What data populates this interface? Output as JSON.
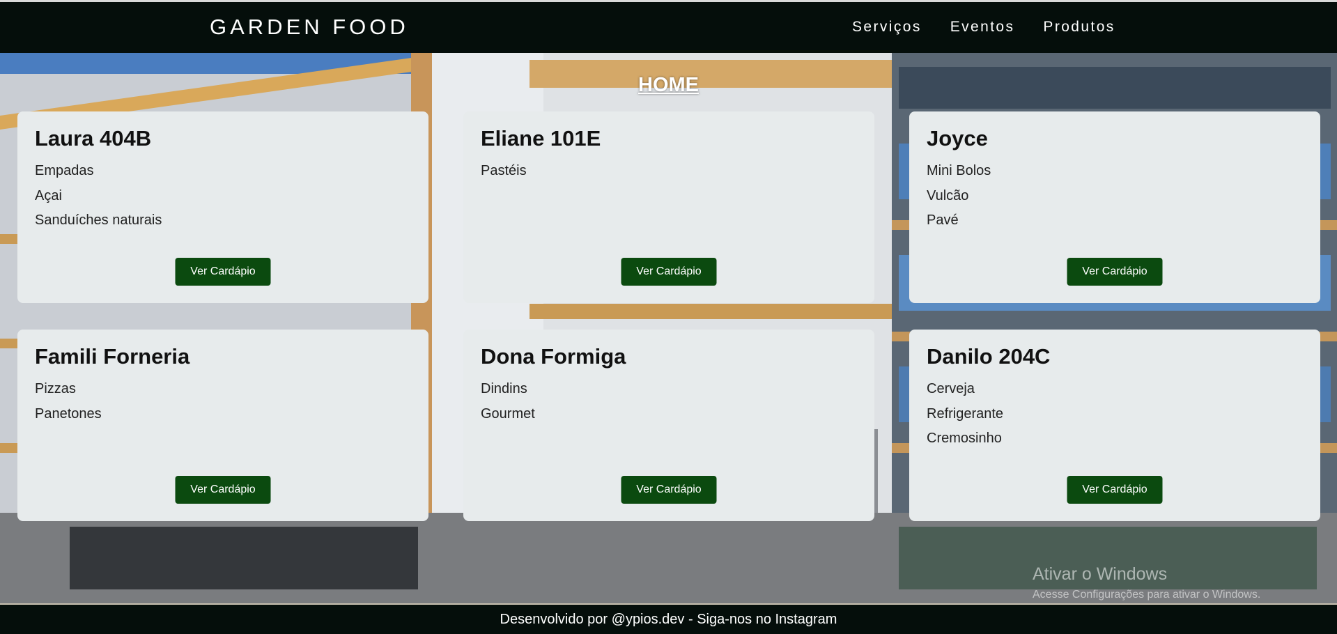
{
  "header": {
    "brand": "GARDEN FOOD",
    "nav": [
      "Serviços",
      "Eventos",
      "Produtos"
    ]
  },
  "page_title": "HOME",
  "cards": [
    {
      "name": "Laura 404B",
      "items": [
        "Empadas",
        "Açai",
        "Sanduíches naturais"
      ],
      "button": "Ver Cardápio"
    },
    {
      "name": "Eliane 101E",
      "items": [
        "Pastéis"
      ],
      "button": "Ver Cardápio"
    },
    {
      "name": "Joyce",
      "items": [
        "Mini Bolos",
        "Vulcão",
        "Pavé"
      ],
      "button": "Ver Cardápio"
    },
    {
      "name": "Famili Forneria",
      "items": [
        "Pizzas",
        "Panetones"
      ],
      "button": "Ver Cardápio"
    },
    {
      "name": "Dona Formiga",
      "items": [
        "Dindins",
        "Gourmet"
      ],
      "button": "Ver Cardápio"
    },
    {
      "name": "Danilo 204C",
      "items": [
        "Cerveja",
        "Refrigerante",
        "Cremosinho"
      ],
      "button": "Ver Cardápio"
    }
  ],
  "watermark": {
    "title": "Ativar o Windows",
    "subtitle": "Acesse Configurações para ativar o Windows."
  },
  "footer": {
    "text": "Desenvolvido por @ypios.dev - Siga-nos no Instagram"
  },
  "colors": {
    "header_bg": "#050e0b",
    "card_bg": "#e7ebec",
    "button_bg": "#0b4a0f"
  }
}
